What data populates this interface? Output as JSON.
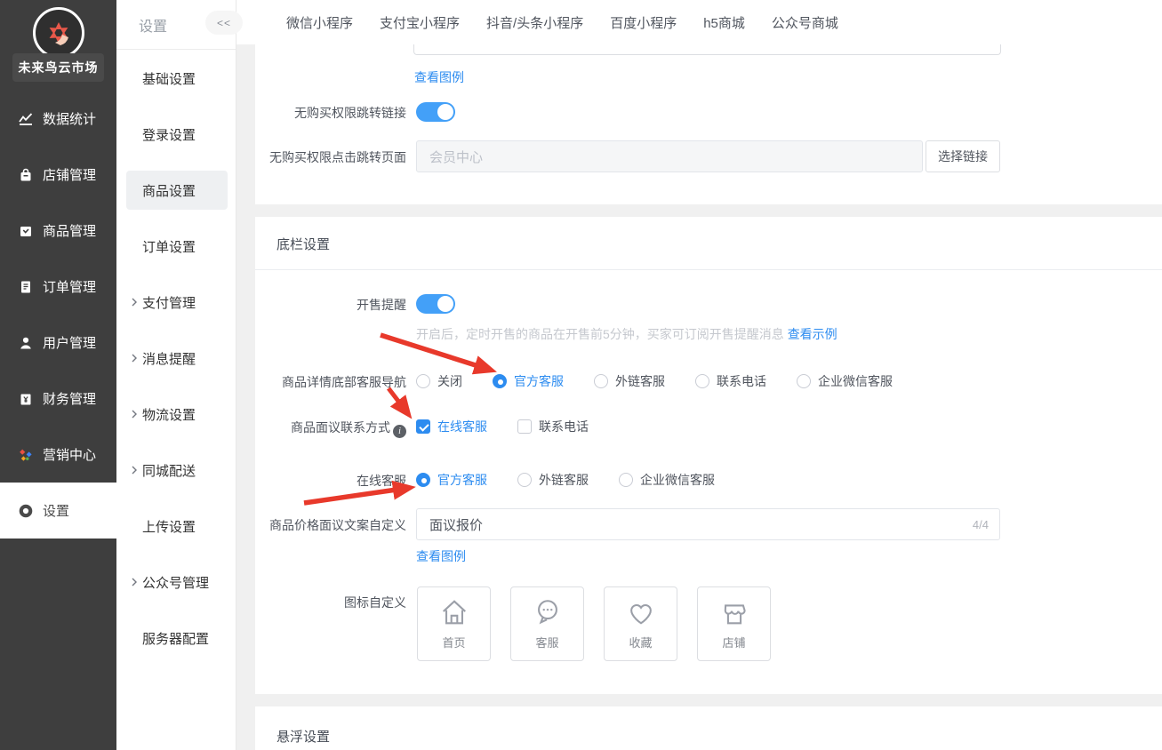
{
  "colors": {
    "accent": "#2d8cf0",
    "toggle_on": "#43a0f8",
    "annotation_arrow": "#e8392b",
    "sidebar_bg": "#3e3e3e"
  },
  "leftSidebar": {
    "brand": "未来鸟云市场",
    "items": [
      {
        "icon": "chart-icon",
        "label": "数据统计"
      },
      {
        "icon": "shop-icon",
        "label": "店铺管理"
      },
      {
        "icon": "goods-icon",
        "label": "商品管理"
      },
      {
        "icon": "order-icon",
        "label": "订单管理"
      },
      {
        "icon": "user-icon",
        "label": "用户管理"
      },
      {
        "icon": "finance-icon",
        "label": "财务管理"
      },
      {
        "icon": "marketing-icon",
        "label": "营销中心"
      },
      {
        "icon": "gear-icon",
        "label": "设置",
        "selected": true
      }
    ]
  },
  "subSidebar": {
    "title": "设置",
    "collapse_label": "<<",
    "items": [
      {
        "label": "基础设置"
      },
      {
        "label": "登录设置"
      },
      {
        "label": "商品设置",
        "selected": true
      },
      {
        "label": "订单设置"
      },
      {
        "label": "支付管理",
        "expandable": true
      },
      {
        "label": "消息提醒",
        "expandable": true
      },
      {
        "label": "物流设置",
        "expandable": true
      },
      {
        "label": "同城配送",
        "expandable": true
      },
      {
        "label": "上传设置"
      },
      {
        "label": "公众号管理",
        "expandable": true
      },
      {
        "label": "服务器配置"
      }
    ]
  },
  "tabs": {
    "items": [
      {
        "label": "微信小程序"
      },
      {
        "label": "支付宝小程序"
      },
      {
        "label": "抖音/头条小程序"
      },
      {
        "label": "百度小程序"
      },
      {
        "label": "h5商城"
      },
      {
        "label": "公众号商城"
      }
    ]
  },
  "card1": {
    "view_example_link": "查看图例",
    "no_permission_toggle_label": "无购买权限跳转链接",
    "no_permission_toggle_state": "on",
    "no_permission_page_label": "无购买权限点击跳转页面",
    "no_permission_page_value": "会员中心",
    "choose_link_button": "选择链接"
  },
  "card2": {
    "title": "底栏设置",
    "sale_reminder_label": "开售提醒",
    "sale_reminder_state": "on",
    "sale_reminder_help": "开启后，定时开售的商品在开售前5分钟，买家可订阅开售提醒消息",
    "sale_reminder_example_link": "查看示例",
    "nav_label": "商品详情底部客服导航",
    "nav_options": [
      "关闭",
      "官方客服",
      "外链客服",
      "联系电话",
      "企业微信客服"
    ],
    "nav_selected": "官方客服",
    "contact_label": "商品面议联系方式",
    "contact_options": [
      "在线客服",
      "联系电话"
    ],
    "contact_checked": "在线客服",
    "online_label": "在线客服",
    "online_options": [
      "官方客服",
      "外链客服",
      "企业微信客服"
    ],
    "online_selected": "官方客服",
    "price_label": "商品价格面议文案自定义",
    "price_value": "面议报价",
    "price_counter": "4/4",
    "view_example_link": "查看图例",
    "icon_custom_label": "图标自定义",
    "icon_cards": [
      {
        "icon": "home-icon",
        "label": "首页"
      },
      {
        "icon": "service-icon",
        "label": "客服"
      },
      {
        "icon": "favorite-icon",
        "label": "收藏"
      },
      {
        "icon": "store-icon",
        "label": "店铺"
      }
    ]
  },
  "card3": {
    "title": "悬浮设置"
  }
}
